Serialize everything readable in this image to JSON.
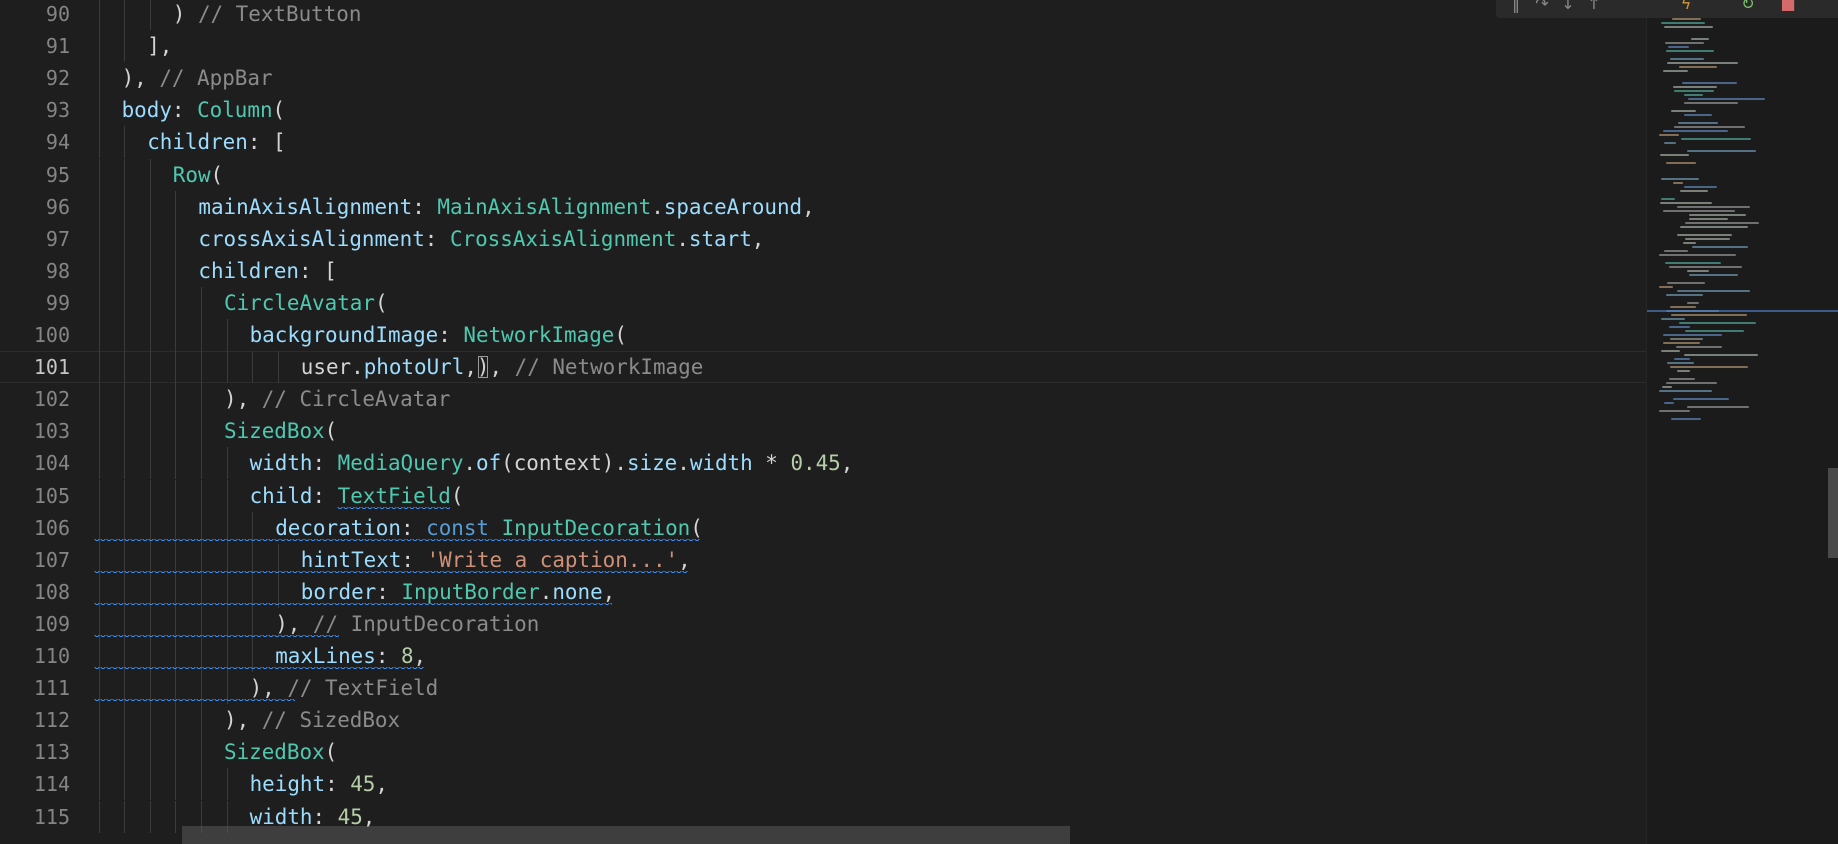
{
  "editor": {
    "active_line": 101,
    "lines": [
      {
        "n": 90,
        "indent": 3,
        "tokens": [
          [
            ") ",
            "plain"
          ],
          [
            "// TextButton",
            "cmt"
          ]
        ]
      },
      {
        "n": 91,
        "indent": 2,
        "tokens": [
          [
            "],",
            "plain"
          ]
        ]
      },
      {
        "n": 92,
        "indent": 1,
        "tokens": [
          [
            "), ",
            "plain"
          ],
          [
            "// AppBar",
            "cmt"
          ]
        ]
      },
      {
        "n": 93,
        "indent": 1,
        "tokens": [
          [
            "body",
            "prop"
          ],
          [
            ": ",
            "plain"
          ],
          [
            "Column",
            "class"
          ],
          [
            "(",
            "plain"
          ]
        ]
      },
      {
        "n": 94,
        "indent": 2,
        "tokens": [
          [
            "children",
            "prop"
          ],
          [
            ": [",
            "plain"
          ]
        ]
      },
      {
        "n": 95,
        "indent": 3,
        "tokens": [
          [
            "Row",
            "class"
          ],
          [
            "(",
            "plain"
          ]
        ]
      },
      {
        "n": 96,
        "indent": 4,
        "tokens": [
          [
            "mainAxisAlignment",
            "prop"
          ],
          [
            ": ",
            "plain"
          ],
          [
            "MainAxisAlignment",
            "class"
          ],
          [
            ".",
            "plain"
          ],
          [
            "spaceAround",
            "member"
          ],
          [
            ",",
            "plain"
          ]
        ]
      },
      {
        "n": 97,
        "indent": 4,
        "tokens": [
          [
            "crossAxisAlignment",
            "prop"
          ],
          [
            ": ",
            "plain"
          ],
          [
            "CrossAxisAlignment",
            "class"
          ],
          [
            ".",
            "plain"
          ],
          [
            "start",
            "member"
          ],
          [
            ",",
            "plain"
          ]
        ]
      },
      {
        "n": 98,
        "indent": 4,
        "tokens": [
          [
            "children",
            "prop"
          ],
          [
            ": [",
            "plain"
          ]
        ]
      },
      {
        "n": 99,
        "indent": 5,
        "tokens": [
          [
            "CircleAvatar",
            "class"
          ],
          [
            "(",
            "plain"
          ]
        ]
      },
      {
        "n": 100,
        "indent": 6,
        "tokens": [
          [
            "backgroundImage",
            "prop"
          ],
          [
            ": ",
            "plain"
          ],
          [
            "NetworkImage",
            "class"
          ],
          [
            "(",
            "plain"
          ]
        ]
      },
      {
        "n": 101,
        "indent": 8,
        "tokens": [
          [
            "user",
            "plain"
          ],
          [
            ".",
            "plain"
          ],
          [
            "photoUrl",
            "member"
          ],
          [
            ",",
            "plain"
          ],
          [
            ")",
            "caret"
          ],
          [
            ", ",
            "plain"
          ],
          [
            "// NetworkImage",
            "cmt"
          ]
        ]
      },
      {
        "n": 102,
        "indent": 5,
        "tokens": [
          [
            "), ",
            "plain"
          ],
          [
            "// CircleAvatar",
            "cmt"
          ]
        ]
      },
      {
        "n": 103,
        "indent": 5,
        "tokens": [
          [
            "SizedBox",
            "class"
          ],
          [
            "(",
            "plain"
          ]
        ]
      },
      {
        "n": 104,
        "indent": 6,
        "tokens": [
          [
            "width",
            "prop"
          ],
          [
            ": ",
            "plain"
          ],
          [
            "MediaQuery",
            "class"
          ],
          [
            ".",
            "plain"
          ],
          [
            "of",
            "member"
          ],
          [
            "(context).",
            "plain"
          ],
          [
            "size",
            "member"
          ],
          [
            ".",
            "plain"
          ],
          [
            "width",
            "member"
          ],
          [
            " * ",
            "plain"
          ],
          [
            "0.45",
            "num"
          ],
          [
            ",",
            "plain"
          ]
        ]
      },
      {
        "n": 105,
        "indent": 6,
        "tokens": [
          [
            "child",
            "prop"
          ],
          [
            ": ",
            "plain"
          ],
          [
            "TextField",
            "class"
          ],
          [
            "(",
            "plain"
          ]
        ]
      },
      {
        "n": 106,
        "indent": 7,
        "tokens": [
          [
            "decoration",
            "prop"
          ],
          [
            ": ",
            "plain"
          ],
          [
            "const ",
            "kw"
          ],
          [
            "InputDecoration",
            "class"
          ],
          [
            "(",
            "plain"
          ]
        ]
      },
      {
        "n": 107,
        "indent": 8,
        "tokens": [
          [
            "hintText",
            "prop"
          ],
          [
            ": ",
            "plain"
          ],
          [
            "'Write a caption...'",
            "str"
          ],
          [
            ",",
            "plain"
          ]
        ]
      },
      {
        "n": 108,
        "indent": 8,
        "tokens": [
          [
            "border",
            "prop"
          ],
          [
            ": ",
            "plain"
          ],
          [
            "InputBorder",
            "class"
          ],
          [
            ".",
            "plain"
          ],
          [
            "none",
            "member"
          ],
          [
            ",",
            "plain"
          ]
        ]
      },
      {
        "n": 109,
        "indent": 7,
        "tokens": [
          [
            "), ",
            "plain"
          ],
          [
            "// InputDecoration",
            "cmt"
          ]
        ]
      },
      {
        "n": 110,
        "indent": 7,
        "tokens": [
          [
            "maxLines",
            "prop"
          ],
          [
            ": ",
            "plain"
          ],
          [
            "8",
            "num"
          ],
          [
            ",",
            "plain"
          ]
        ]
      },
      {
        "n": 111,
        "indent": 6,
        "tokens": [
          [
            "), ",
            "plain"
          ],
          [
            "// TextField",
            "cmt"
          ]
        ]
      },
      {
        "n": 112,
        "indent": 5,
        "tokens": [
          [
            "), ",
            "plain"
          ],
          [
            "// SizedBox",
            "cmt"
          ]
        ]
      },
      {
        "n": 113,
        "indent": 5,
        "tokens": [
          [
            "SizedBox",
            "class"
          ],
          [
            "(",
            "plain"
          ]
        ]
      },
      {
        "n": 114,
        "indent": 6,
        "tokens": [
          [
            "height",
            "prop"
          ],
          [
            ": ",
            "plain"
          ],
          [
            "45",
            "num"
          ],
          [
            ",",
            "plain"
          ]
        ]
      },
      {
        "n": 115,
        "indent": 6,
        "tokens": [
          [
            "width",
            "prop"
          ],
          [
            ": ",
            "plain"
          ],
          [
            "45",
            "num"
          ],
          [
            ",",
            "plain"
          ]
        ]
      }
    ],
    "squiggle_lines": [
      106,
      107,
      108,
      109,
      110,
      111
    ],
    "linked_error_underline": {
      "line": 105,
      "token": "TextField"
    }
  },
  "colors": {
    "background": "#1e1e1e",
    "property": "#9cdcfe",
    "class": "#4ec9b0",
    "number": "#b5cea8",
    "string": "#ce9178",
    "keyword": "#569cd6",
    "comment": "#8b8b8b",
    "squiggle": "#3794ff"
  },
  "toolbar": {
    "icons": [
      "pause-icon",
      "step-over-icon",
      "step-into-icon",
      "step-out-icon",
      "restart-icon",
      "hot-reload-icon",
      "stop-icon"
    ]
  }
}
